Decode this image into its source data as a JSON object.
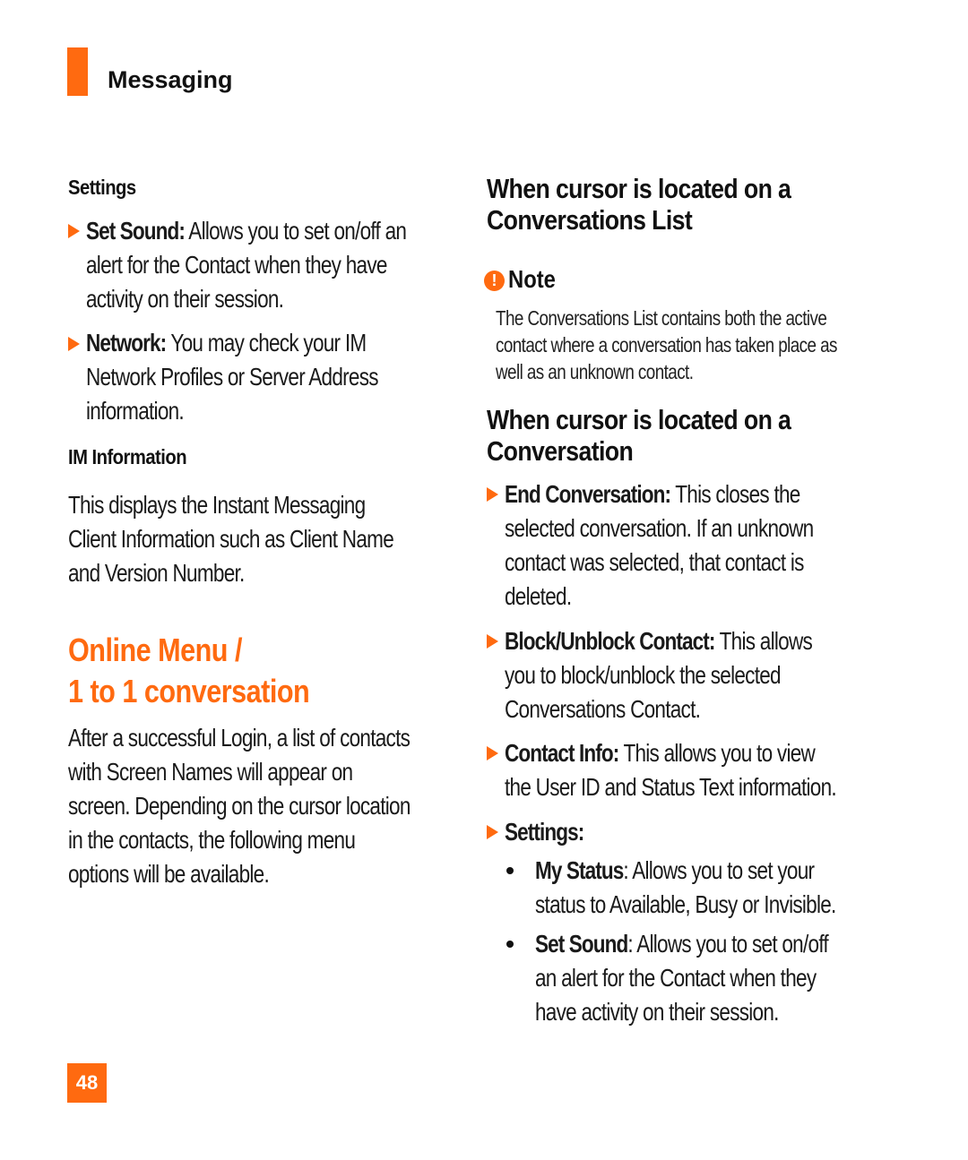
{
  "header": {
    "section_title": "Messaging",
    "accent_color": "#ff6a10"
  },
  "left": {
    "settings_heading": "Settings",
    "settings_items": [
      {
        "term": "Set Sound:",
        "lines": [
          " Allows you to set on/off an",
          "alert for the Contact when they have",
          "activity on their session."
        ]
      },
      {
        "term": "Network:",
        "lines": [
          " You may check your IM",
          "Network Profiles or Server Address",
          "information."
        ]
      }
    ],
    "im_heading": "IM Information",
    "im_lines": [
      "This displays the Instant Messaging",
      "Client Information such as Client Name",
      "and Version Number."
    ],
    "online_heading_lines": [
      "Online Menu /",
      "1 to 1 conversation"
    ],
    "online_lines": [
      "After a successful Login, a list of contacts",
      "with Screen Names will appear on",
      "screen. Depending on the cursor location",
      "in the contacts, the following menu",
      "options will be available."
    ]
  },
  "right": {
    "list_heading_lines": [
      "When cursor is located on a",
      "Conversations List"
    ],
    "note": {
      "icon": "exclamation-icon",
      "label": "Note",
      "lines": [
        "The Conversations List contains both the active",
        "contact where a conversation has taken place as",
        "well as an unknown contact."
      ]
    },
    "conv_heading_lines": [
      "When cursor is located on a",
      "Conversation"
    ],
    "conv_items": [
      {
        "term": "End Conversation:",
        "lines": [
          " This closes the",
          "selected conversation. If an unknown",
          "contact was selected, that contact is",
          "deleted."
        ]
      },
      {
        "term": "Block/Unblock Contact:",
        "lines": [
          " This allows",
          "you to block/unblock the selected",
          "Conversations Contact."
        ]
      },
      {
        "term": "Contact Info:",
        "lines": [
          " This allows you to view",
          "the User ID and Status Text information."
        ]
      },
      {
        "term": "Settings:",
        "lines": [
          ""
        ]
      }
    ],
    "sub_items": [
      {
        "term": "My Status",
        "lines": [
          ": Allows you to set your",
          "status to Available, Busy or Invisible."
        ]
      },
      {
        "term": "Set Sound",
        "lines": [
          ": Allows you to set on/off",
          "an alert for the Contact when they",
          "have activity on their session."
        ]
      }
    ]
  },
  "footer": {
    "page_number": "48"
  }
}
